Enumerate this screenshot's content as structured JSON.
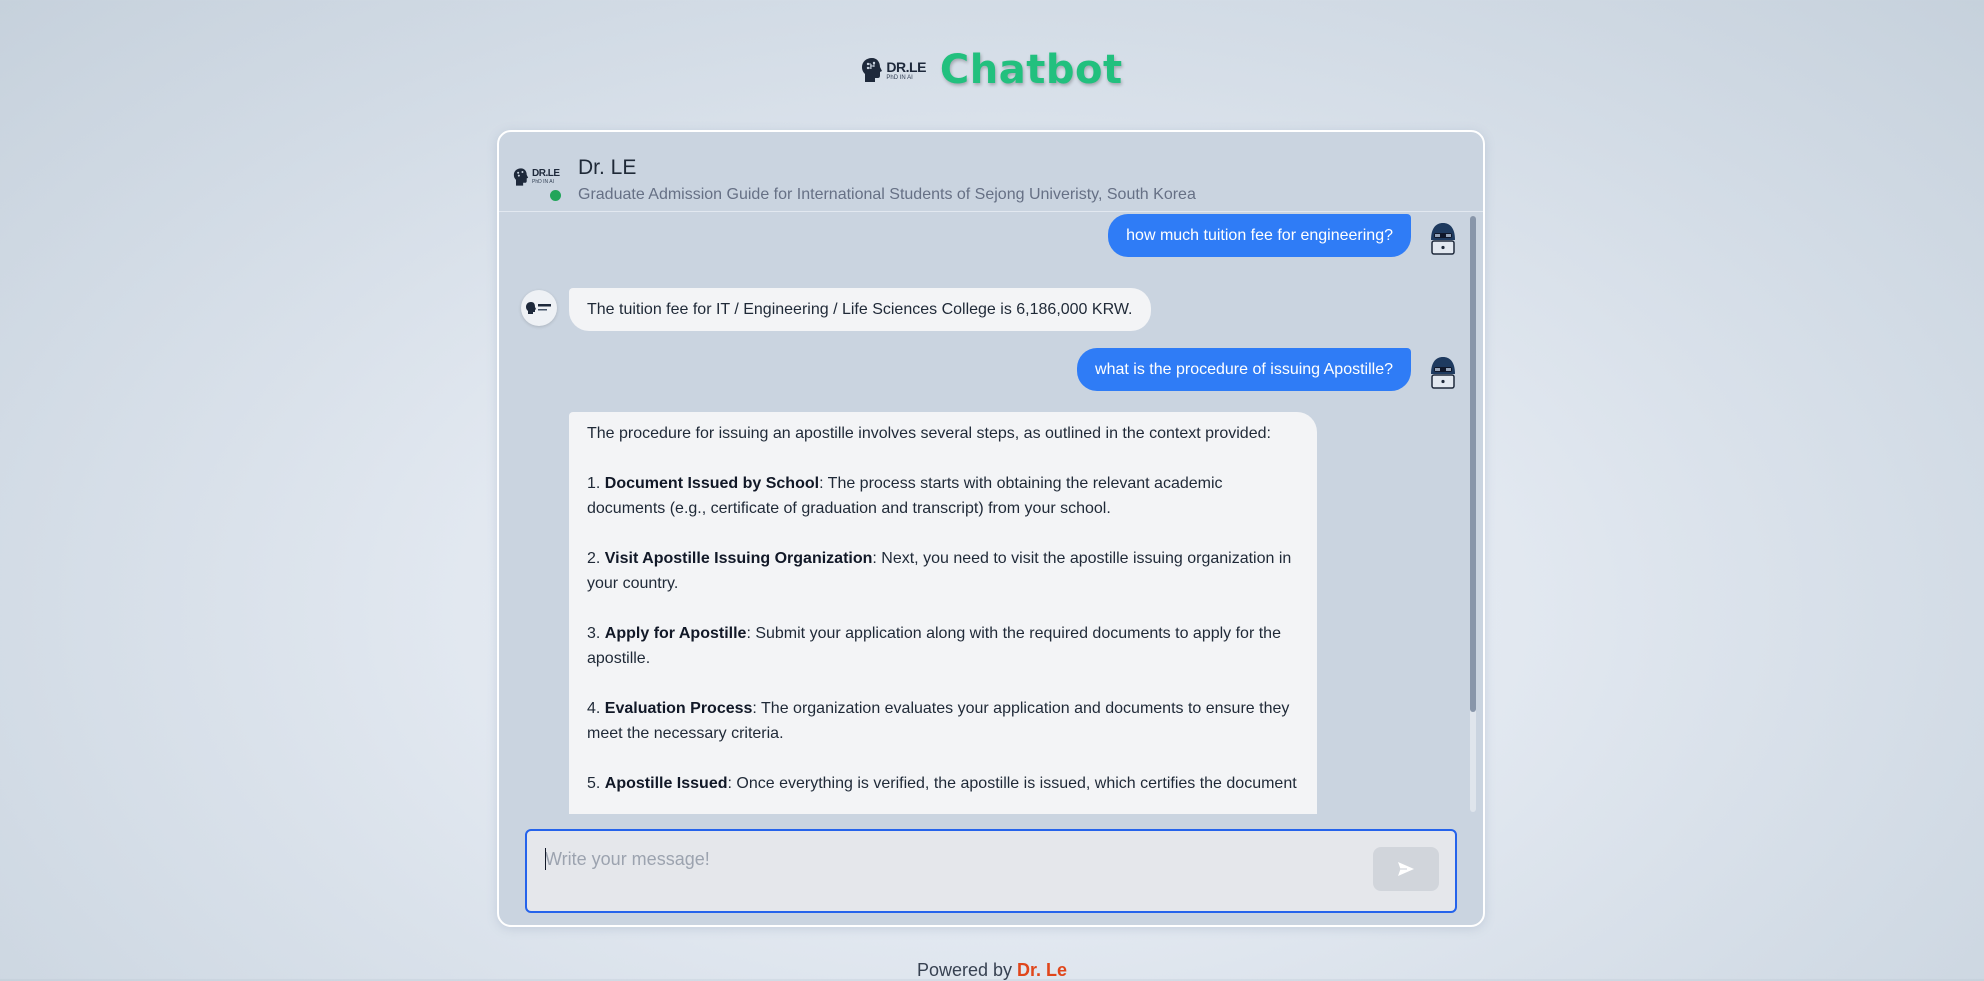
{
  "app": {
    "logo_main": "DR.LE",
    "logo_sub": "PhD IN AI",
    "title": "Chatbot"
  },
  "chat_header": {
    "bot_name": "Dr. LE",
    "subtitle": "Graduate Admission Guide for International Students of Sejong Univeristy, South Korea",
    "status": "online"
  },
  "messages": [
    {
      "role": "user",
      "text": "how much tuition fee for engineering?"
    },
    {
      "role": "bot",
      "text": "The tuition fee for IT / Engineering / Life Sciences College is 6,186,000 KRW."
    },
    {
      "role": "user",
      "text": "what is the procedure of issuing Apostille?"
    },
    {
      "role": "bot",
      "intro": "The procedure for issuing an apostille involves several steps, as outlined in the context provided:",
      "steps": [
        {
          "num": "1.",
          "title": "Document Issued by School",
          "text": ": The process starts with obtaining the relevant academic documents (e.g., certificate of graduation and transcript) from your school."
        },
        {
          "num": "2.",
          "title": "Visit Apostille Issuing Organization",
          "text": ": Next, you need to visit the apostille issuing organization in your country."
        },
        {
          "num": "3.",
          "title": "Apply for Apostille",
          "text": ": Submit your application along with the required documents to apply for the apostille."
        },
        {
          "num": "4.",
          "title": "Evaluation Process",
          "text": ": The organization evaluates your application and documents to ensure they meet the necessary criteria."
        },
        {
          "num": "5.",
          "title": "Apostille Issued",
          "text": ": Once everything is verified, the apostille is issued, which certifies the document"
        }
      ]
    }
  ],
  "composer": {
    "placeholder": "Write your message!",
    "send_icon": "send-icon"
  },
  "footer": {
    "prefix": "Powered by",
    "brand": "Dr. Le"
  },
  "colors": {
    "title_green": "#22c07e",
    "user_bubble": "#2f7cf6",
    "bot_bubble": "#f3f4f6",
    "online": "#22a55a",
    "accent_border": "#2563eb",
    "footer_brand": "#e0461b"
  }
}
